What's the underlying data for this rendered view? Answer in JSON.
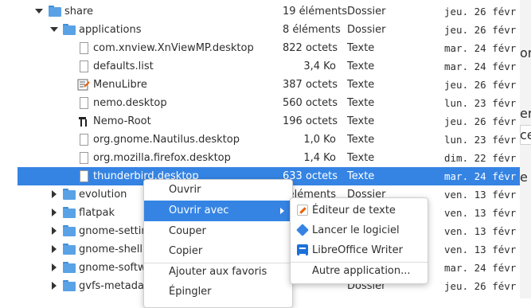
{
  "files": [
    {
      "name": "share",
      "size": "19 éléments",
      "type": "Dossier",
      "date": "jeu. 26 févr",
      "icon": "folder-icon",
      "expander": "expanded",
      "depth": 0
    },
    {
      "name": "applications",
      "size": "8 éléments",
      "type": "Dossier",
      "date": "jeu. 26 févr",
      "icon": "folder-icon",
      "expander": "expanded",
      "depth": 1
    },
    {
      "name": "com.xnview.XnViewMP.desktop",
      "size": "822 octets",
      "type": "Texte",
      "date": "mar. 24 févr",
      "icon": "file-icon",
      "depth": 2
    },
    {
      "name": "defaults.list",
      "size": "3,4 Ko",
      "type": "Texte",
      "date": "mar. 24 févr",
      "icon": "file-icon",
      "depth": 2
    },
    {
      "name": "MenuLibre",
      "size": "387 octets",
      "type": "Texte",
      "date": "jeu. 26 févr",
      "icon": "menulibre-icon",
      "depth": 2
    },
    {
      "name": "nemo.desktop",
      "size": "560 octets",
      "type": "Texte",
      "date": "lun. 23 févr",
      "icon": "file-icon",
      "depth": 2
    },
    {
      "name": "Nemo-Root",
      "size": "196 octets",
      "type": "Texte",
      "date": "jeu. 26 févr",
      "icon": "tools-icon",
      "depth": 2
    },
    {
      "name": "org.gnome.Nautilus.desktop",
      "size": "1,0 Ko",
      "type": "Texte",
      "date": "lun. 23 févr",
      "icon": "file-icon",
      "depth": 2
    },
    {
      "name": "org.mozilla.firefox.desktop",
      "size": "1,4 Ko",
      "type": "Texte",
      "date": "dim. 22 févr",
      "icon": "file-icon",
      "depth": 2
    },
    {
      "name": "thunderbird.desktop",
      "size": "633 octets",
      "type": "Texte",
      "date": "mar. 24 févr",
      "icon": "file-icon",
      "depth": 2,
      "selected": true
    },
    {
      "name": "evolution",
      "size": "éléments",
      "type": "Dossier",
      "date": "ven. 13 févr",
      "icon": "folder-icon",
      "expander": "collapsed",
      "depth": 1
    },
    {
      "name": "flatpak",
      "size": "",
      "type": "",
      "date": "ven. 13 févr",
      "icon": "folder-icon",
      "expander": "collapsed",
      "depth": 1
    },
    {
      "name": "gnome-settings",
      "size": "",
      "type": "",
      "date": "ven. 13 févr",
      "icon": "folder-icon",
      "expander": "collapsed",
      "depth": 1
    },
    {
      "name": "gnome-shell",
      "size": "",
      "type": "",
      "date": "ven. 13 févr",
      "icon": "folder-icon",
      "expander": "collapsed",
      "depth": 1
    },
    {
      "name": "gnome-software",
      "size": "",
      "type": "",
      "date": "mar. 24 févr",
      "icon": "folder-icon",
      "expander": "collapsed",
      "depth": 1
    },
    {
      "name": "gvfs-metadata",
      "size": "",
      "type": "Dossier",
      "date": "jeu. 26 févr",
      "icon": "folder-icon",
      "expander": "collapsed",
      "depth": 1
    }
  ],
  "context_menu": {
    "items": [
      {
        "label": "Ouvrir"
      },
      {
        "label": "Ouvrir avec",
        "highlighted": true,
        "submenu": true
      },
      {
        "label": "Couper"
      },
      {
        "label": "Copier"
      },
      {
        "label": "Ajouter aux favoris"
      },
      {
        "label": "Épingler"
      }
    ]
  },
  "submenu": {
    "items": [
      {
        "label": "Éditeur de texte",
        "icon": "text-editor-icon"
      },
      {
        "label": "Lancer le logiciel",
        "icon": "launch-icon"
      },
      {
        "label": "LibreOffice Writer",
        "icon": "writer-icon"
      },
      {
        "label": "Autre application..."
      }
    ]
  },
  "side_fragments": [
    "or",
    "erf",
    "ce",
    "e"
  ],
  "colors": {
    "selection": "#3584e4",
    "folder": "#5aa2e6"
  }
}
